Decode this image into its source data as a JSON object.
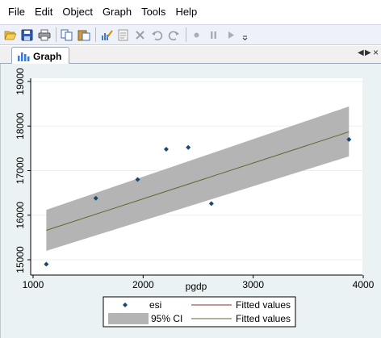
{
  "menu": {
    "items": [
      {
        "label": "File"
      },
      {
        "label": "Edit"
      },
      {
        "label": "Object"
      },
      {
        "label": "Graph"
      },
      {
        "label": "Tools"
      },
      {
        "label": "Help"
      }
    ]
  },
  "toolbar": {
    "icons": [
      "open-icon",
      "save-icon",
      "print-icon",
      "copy-icon",
      "paste-icon",
      "graph-editor-icon",
      "object-browser-icon",
      "pointer-icon",
      "undo-icon",
      "redo-icon",
      "record-icon",
      "pause-icon",
      "play-icon"
    ]
  },
  "tab": {
    "label": "Graph"
  },
  "chart_data": {
    "type": "scatter",
    "xlabel": "pgdp",
    "ylabel": "",
    "xlim": [
      1000,
      4000
    ],
    "ylim": [
      14900,
      19100
    ],
    "x_ticks": [
      "1000",
      "2000",
      "3000",
      "4000"
    ],
    "y_ticks": [
      "15000",
      "16000",
      "17000",
      "18000",
      "19000"
    ],
    "grid": true,
    "series": [
      {
        "name": "esi",
        "kind": "scatter",
        "color": "#1a476f",
        "points": [
          [
            1120,
            14900
          ],
          [
            1570,
            16380
          ],
          [
            1950,
            16800
          ],
          [
            2210,
            17480
          ],
          [
            2410,
            17520
          ],
          [
            2620,
            16260
          ],
          [
            3870,
            17700
          ]
        ]
      },
      {
        "name": "Fitted values",
        "kind": "line",
        "color": "#556b2f",
        "points": [
          [
            1120,
            15660
          ],
          [
            3870,
            17870
          ]
        ]
      }
    ],
    "ci_band": {
      "name": "95% CI",
      "color": "#b4b4b4",
      "x": [
        1120,
        3870
      ],
      "lower": [
        15200,
        17320
      ],
      "upper": [
        16120,
        18440
      ]
    },
    "legend": {
      "placement": "bottom",
      "entries": [
        {
          "label": "esi"
        },
        {
          "label": "Fitted values",
          "color": "#8b2c2c"
        },
        {
          "label": "95% CI"
        },
        {
          "label": "Fitted values",
          "color": "#556b2f"
        }
      ]
    }
  }
}
